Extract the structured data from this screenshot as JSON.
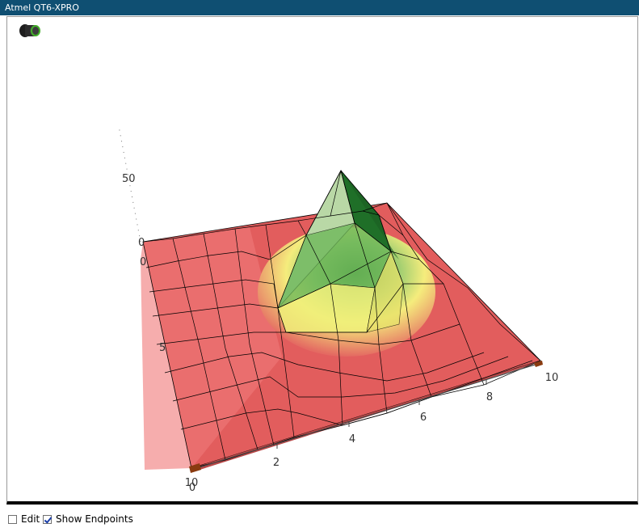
{
  "window": {
    "title": "Atmel QT6-XPRO"
  },
  "plot": {
    "axis_x_ticks": [
      "2",
      "4",
      "6",
      "8",
      "10"
    ],
    "axis_y_ticks": [
      "0",
      "5",
      "10"
    ],
    "axis_z_ticks": [
      "0",
      "50"
    ],
    "origin_label": "0",
    "colors": {
      "low": "#e85a5a",
      "mid": "#f4f47a",
      "high": "#1f7a2a"
    }
  },
  "controls": {
    "edit": {
      "label": "Edit",
      "checked": false
    },
    "show_endpoints": {
      "label": "Show Endpoints",
      "checked": true
    }
  }
}
